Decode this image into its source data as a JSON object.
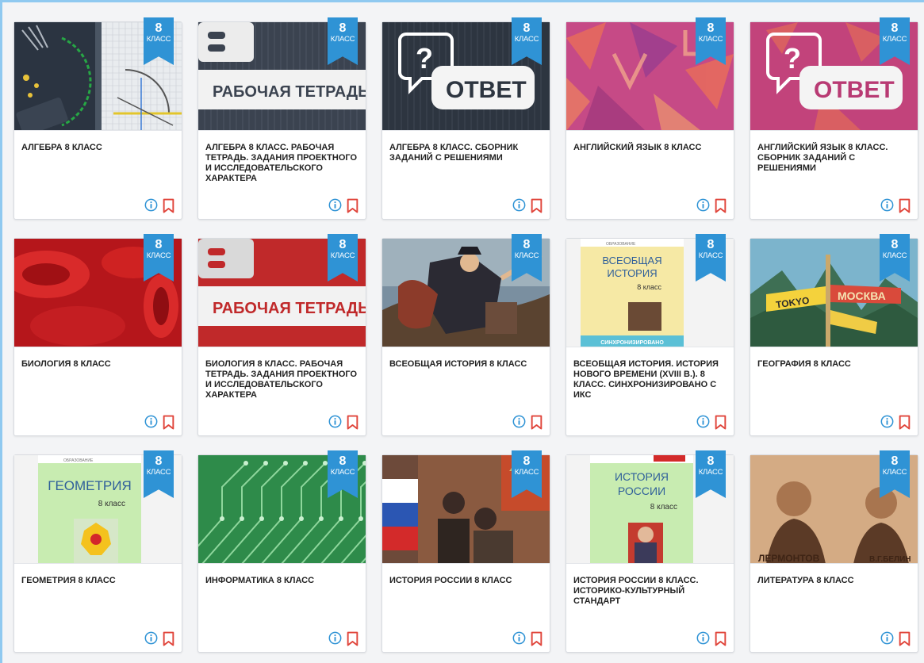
{
  "grade_badge": {
    "number": "8",
    "label": "КЛАСС"
  },
  "colors": {
    "badge": "#2f93d5",
    "info": "#2f93d5",
    "bookmark": "#e0443a",
    "frame": "#8fc9f0"
  },
  "icons": {
    "info": "info-icon",
    "bookmark": "bookmark-icon"
  },
  "cards": [
    {
      "title": "АЛГЕБРА 8 КЛАСС",
      "cover": "algebra"
    },
    {
      "title": "АЛГЕБРА 8 КЛАСС. РАБОЧАЯ ТЕТРАДЬ. ЗАДАНИЯ ПРОЕКТНОГО И ИССЛЕДОВАТЕЛЬСКОГО ХАРАКТЕРА",
      "cover": "workbook-gray",
      "cover_text": "РАБОЧАЯ ТЕТРАДЬ"
    },
    {
      "title": "АЛГЕБРА 8 КЛАСС. СБОРНИК ЗАДАНИЙ С РЕШЕНИЯМИ",
      "cover": "answer-dark",
      "cover_text": "ОТВЕТ"
    },
    {
      "title": "АНГЛИЙСКИЙ ЯЗЫК 8 КЛАСС",
      "cover": "english"
    },
    {
      "title": "АНГЛИЙСКИЙ ЯЗЫК 8 КЛАСС. СБОРНИК ЗАДАНИЙ С РЕШЕНИЯМИ",
      "cover": "answer-pink",
      "cover_text": "ОТВЕТ"
    },
    {
      "title": "БИОЛОГИЯ 8 КЛАСС",
      "cover": "biology"
    },
    {
      "title": "БИОЛОГИЯ 8 КЛАСС. РАБОЧАЯ ТЕТРАДЬ. ЗАДАНИЯ ПРОЕКТНОГО И ИССЛЕДОВАТЕЛЬСКОГО ХАРАКТЕРА",
      "cover": "workbook-red",
      "cover_text": "РАБОЧАЯ ТЕТРАДЬ"
    },
    {
      "title": "ВСЕОБЩАЯ ИСТОРИЯ 8 КЛАСС",
      "cover": "painting"
    },
    {
      "title": "ВСЕОБЩАЯ ИСТОРИЯ. ИСТОРИЯ НОВОГО ВРЕМЕНИ (XVIII В.). 8 КЛАСС. СИНХРОНИЗИРОВАНО С ИКС",
      "cover": "book-history",
      "cover_text": "ВСЕОБЩАЯ ИСТОРИЯ",
      "cover_sub": "8 класс",
      "cover_band": "СИНХРОНИЗИРОВАНО"
    },
    {
      "title": "ГЕОГРАФИЯ 8 КЛАСС",
      "cover": "geography",
      "cover_text": "МОСКВА",
      "cover_sub": "TOKYO"
    },
    {
      "title": "ГЕОМЕТРИЯ 8 КЛАСС",
      "cover": "book-geometry",
      "cover_text": "ГЕОМЕТРИЯ",
      "cover_sub": "8 класс"
    },
    {
      "title": "ИНФОРМАТИКА 8 КЛАСС",
      "cover": "circuit"
    },
    {
      "title": "ИСТОРИЯ РОССИИ 8 КЛАСС",
      "cover": "russia"
    },
    {
      "title": "ИСТОРИЯ РОССИИ 8 КЛАСС. ИСТОРИКО-КУЛЬТУРНЫЙ СТАНДАРТ",
      "cover": "book-russia",
      "cover_text": "ИСТОРИЯ РОССИИ",
      "cover_sub": "8 класс"
    },
    {
      "title": "ЛИТЕРАТУРА 8 КЛАСС",
      "cover": "literature",
      "cover_text": "ЛЕРМОНТОВ",
      "cover_sub": "В.Г.БЕЛИН"
    }
  ]
}
